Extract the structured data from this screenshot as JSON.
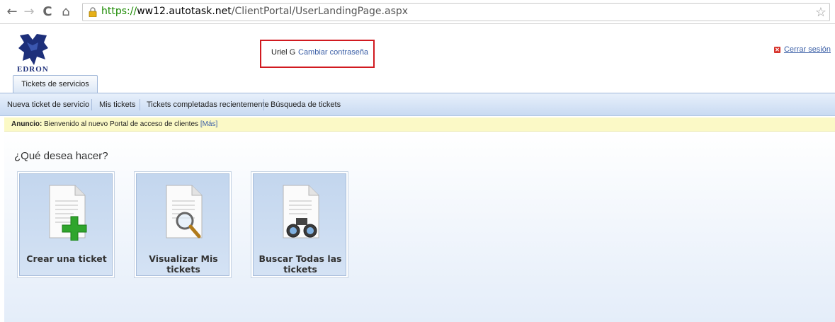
{
  "browser": {
    "url_scheme": "https://",
    "url_host": "ww12.autotask.net",
    "url_path": "/ClientPortal/UserLandingPage.aspx",
    "icons": [
      "back-icon",
      "forward-icon",
      "reload-icon",
      "home-icon",
      "lock-icon",
      "bookmark-star-icon"
    ]
  },
  "header": {
    "logo_text": "EDRON",
    "user_name": "Uriel G",
    "change_password": "Cambiar contraseña",
    "logout": "Cerrar sesión"
  },
  "tabs": [
    {
      "label": "Tickets de servicios"
    }
  ],
  "menu": [
    {
      "label": "Nueva ticket de servicio"
    },
    {
      "label": "Mis tickets"
    },
    {
      "label": "Tickets completadas recientemente"
    },
    {
      "label": "Búsqueda de tickets"
    }
  ],
  "announcement": {
    "prefix": "Anuncio:",
    "text": " Bienvenido al nuevo Portal de acceso de clientes ",
    "more": "[Más]"
  },
  "main": {
    "question": "¿Qué desea hacer?",
    "actions": [
      {
        "label": "Crear una ticket",
        "icon": "add-icon"
      },
      {
        "label": "Visualizar Mis tickets",
        "icon": "magnifier-icon"
      },
      {
        "label": "Buscar Todas las tickets",
        "icon": "binoculars-icon"
      }
    ]
  },
  "colors": {
    "link": "#3a5ea6",
    "highlight_border": "#d11a20",
    "announcement_bg": "#fbf9c6",
    "menubar": "#c9daf2"
  }
}
